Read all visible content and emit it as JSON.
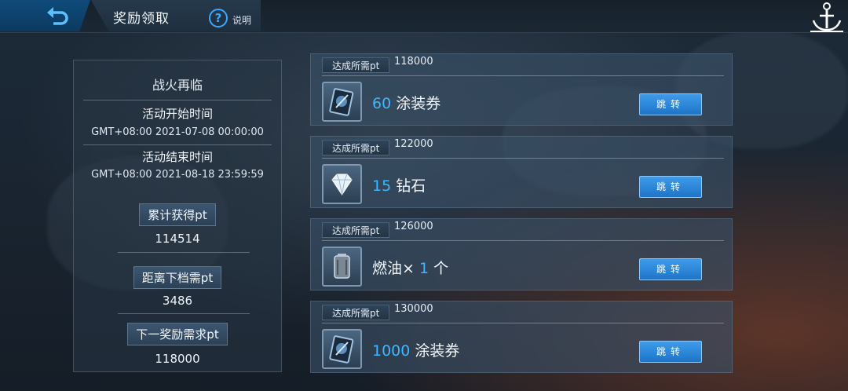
{
  "header": {
    "title": "奖励领取",
    "help_label": "说明"
  },
  "info": {
    "event_name": "战火再临",
    "start_label": "活动开始时间",
    "start_time": "GMT+08:00 2021-07-08 00:00:00",
    "end_label": "活动结束时间",
    "end_time": "GMT+08:00 2021-08-18 23:59:59",
    "accumulated_label": "累计获得pt",
    "accumulated_value": "114514",
    "distance_label": "距离下档需pt",
    "distance_value": "3486",
    "next_label": "下一奖励需求pt",
    "next_value": "118000"
  },
  "rewards": [
    {
      "req_label": "达成所需pt",
      "req_value": "118000",
      "qty": "60",
      "qty_suffix": "",
      "name": "涂装券",
      "name_prefix": "",
      "icon": "skin-ticket-icon",
      "button": "跳转"
    },
    {
      "req_label": "达成所需pt",
      "req_value": "122000",
      "qty": "15",
      "qty_suffix": "",
      "name": "钻石",
      "name_prefix": "",
      "icon": "diamond-icon",
      "button": "跳转"
    },
    {
      "req_label": "达成所需pt",
      "req_value": "126000",
      "qty": "1",
      "qty_suffix": "个",
      "name": "",
      "name_prefix": "燃油× ",
      "icon": "fuel-icon",
      "button": "跳转"
    },
    {
      "req_label": "达成所需pt",
      "req_value": "130000",
      "qty": "1000",
      "qty_suffix": "",
      "name": "涂装券",
      "name_prefix": "",
      "icon": "skin-ticket-icon",
      "button": "跳转"
    }
  ],
  "colors": {
    "accent": "#3fb6ff",
    "button": "#2a86d8"
  }
}
